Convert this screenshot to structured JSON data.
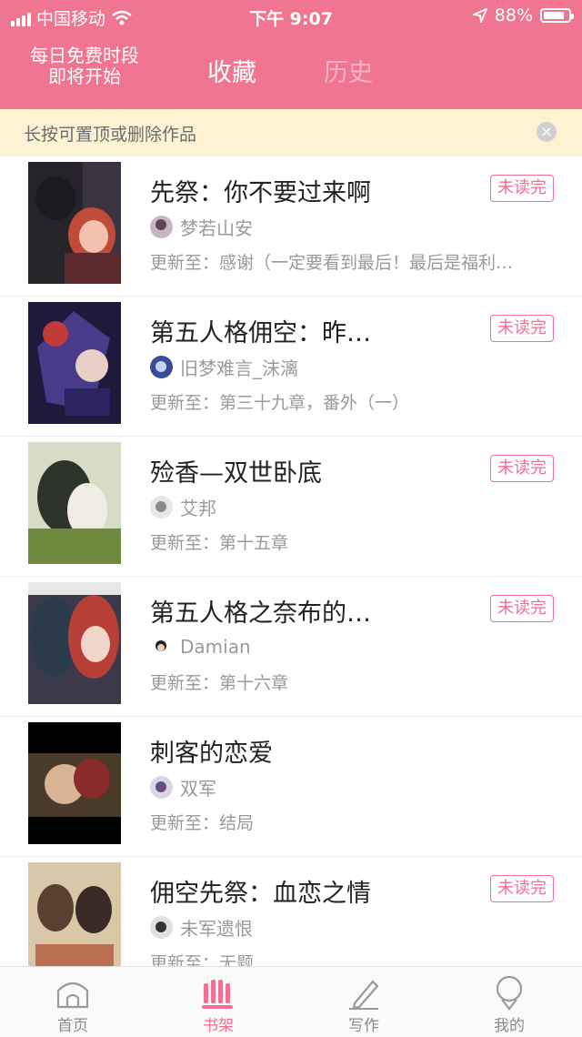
{
  "status_bar": {
    "carrier": "中国移动",
    "time": "下午 9:07",
    "battery": "88%"
  },
  "header": {
    "promo_line1": "每日免费时段",
    "promo_line2": "即将开始",
    "tab_favorites": "收藏",
    "tab_history": "历史"
  },
  "notice": {
    "text": "长按可置顶或删除作品"
  },
  "update_prefix": "更新至：",
  "items": [
    {
      "title": "先祭：你不要过来啊",
      "badge": "未读完",
      "author": "梦若山安",
      "update": "感谢（一定要看到最后！最后是福利…"
    },
    {
      "title": "第五人格佣空：昨…",
      "badge": "未读完",
      "author": "旧梦难言_沫漓",
      "update": "第三十九章，番外（一）"
    },
    {
      "title": "殓香—双世卧底",
      "badge": "未读完",
      "author": "艾邦",
      "update": "第十五章"
    },
    {
      "title": "第五人格之奈布的…",
      "badge": "未读完",
      "author": "Damian",
      "update": "第十六章"
    },
    {
      "title": "刺客的恋爱",
      "badge": "",
      "author": "双军",
      "update": "结局"
    },
    {
      "title": "佣空先祭：血恋之情",
      "badge": "未读完",
      "author": "未军遗恨",
      "update": "无题"
    }
  ],
  "tabbar": {
    "home": "首页",
    "shelf": "书架",
    "write": "写作",
    "mine": "我的"
  },
  "colors": {
    "brand": "#f07590",
    "accent": "#f06f92",
    "notice_bg": "#fdf3d3"
  },
  "icons": [
    "signal-icon",
    "wifi-icon",
    "location-icon",
    "battery-icon",
    "close-icon",
    "home-icon",
    "bookshelf-icon",
    "pencil-icon",
    "profile-icon"
  ]
}
